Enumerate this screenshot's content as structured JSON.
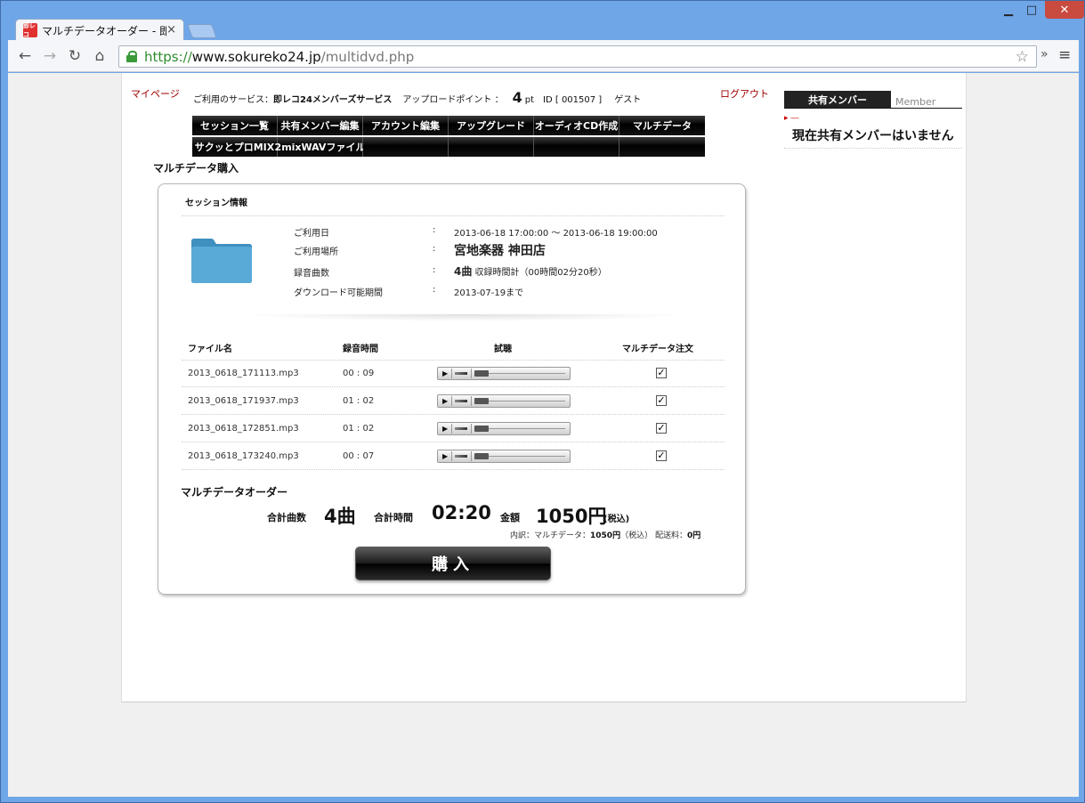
{
  "browser": {
    "tab_title": "マルチデータオーダー - 即レコ",
    "favicon_text": "即レコ",
    "url_scheme": "https://",
    "url_host": "www.sokureko24.jp",
    "url_path": "/multidvd.php"
  },
  "header": {
    "mypage": "マイページ",
    "service_label": "ご利用のサービス：",
    "service_name": "即レコ24メンバーズサービス",
    "points_label": "アップロードポイント ：",
    "points_value": "4",
    "points_unit": "pt",
    "id_text": "ID [ 001507 ]",
    "user": "ゲスト",
    "logout": "ログアウト"
  },
  "nav": {
    "row1": [
      "セッション一覧",
      "共有メンバー編集",
      "アカウント編集",
      "アップグレード",
      "オーディオCD作成",
      "マルチデータ"
    ],
    "row2": [
      "サクッとプロMIX",
      "2mixWAVファイル",
      "",
      "",
      "",
      ""
    ]
  },
  "page_heading": "マルチデータ購入",
  "session": {
    "title": "セッション情報",
    "date_label": "ご利用日",
    "date_value": "2013-06-18 17:00:00 〜 2013-06-18 19:00:00",
    "place_label": "ご利用場所",
    "place_value": "宮地楽器 神田店",
    "count_label": "録音曲数",
    "count_value": "4曲",
    "count_detail": "収録時間計（00時間02分20秒）",
    "download_label": "ダウンロード可能期間",
    "download_value": "2013-07-19まで",
    "colon": ":"
  },
  "table": {
    "headers": [
      "ファイル名",
      "録音時間",
      "試聴",
      "マルチデータ注文"
    ],
    "rows": [
      {
        "file": "2013_0618_171113.mp3",
        "time": "00 : 09",
        "checked": true
      },
      {
        "file": "2013_0618_171937.mp3",
        "time": "01 : 02",
        "checked": true
      },
      {
        "file": "2013_0618_172851.mp3",
        "time": "01 : 02",
        "checked": true
      },
      {
        "file": "2013_0618_173240.mp3",
        "time": "00 : 07",
        "checked": true
      }
    ]
  },
  "order": {
    "title": "マルチデータオーダー",
    "count_label": "合計曲数",
    "count_value": "4曲",
    "time_label": "合計時間",
    "time_value": "02:20",
    "price_label": "金額",
    "price_value": "1050円",
    "tax_note": "(税込)",
    "breakdown_prefix": "内訳：マルチデータ：",
    "breakdown_amount": "1050円",
    "breakdown_tax": "（税込）",
    "shipping_label": "配送料：",
    "shipping_value": "0円",
    "buy_button": "購入"
  },
  "sidebar": {
    "tab_label": "共有メンバー",
    "tab_label_en": "Member",
    "mark": "▸ ―",
    "empty_message": "現在共有メンバーはいません"
  },
  "colors": {
    "link_red": "#a00000",
    "nav_black": "#000000",
    "folder_blue": "#4a9ccc"
  }
}
